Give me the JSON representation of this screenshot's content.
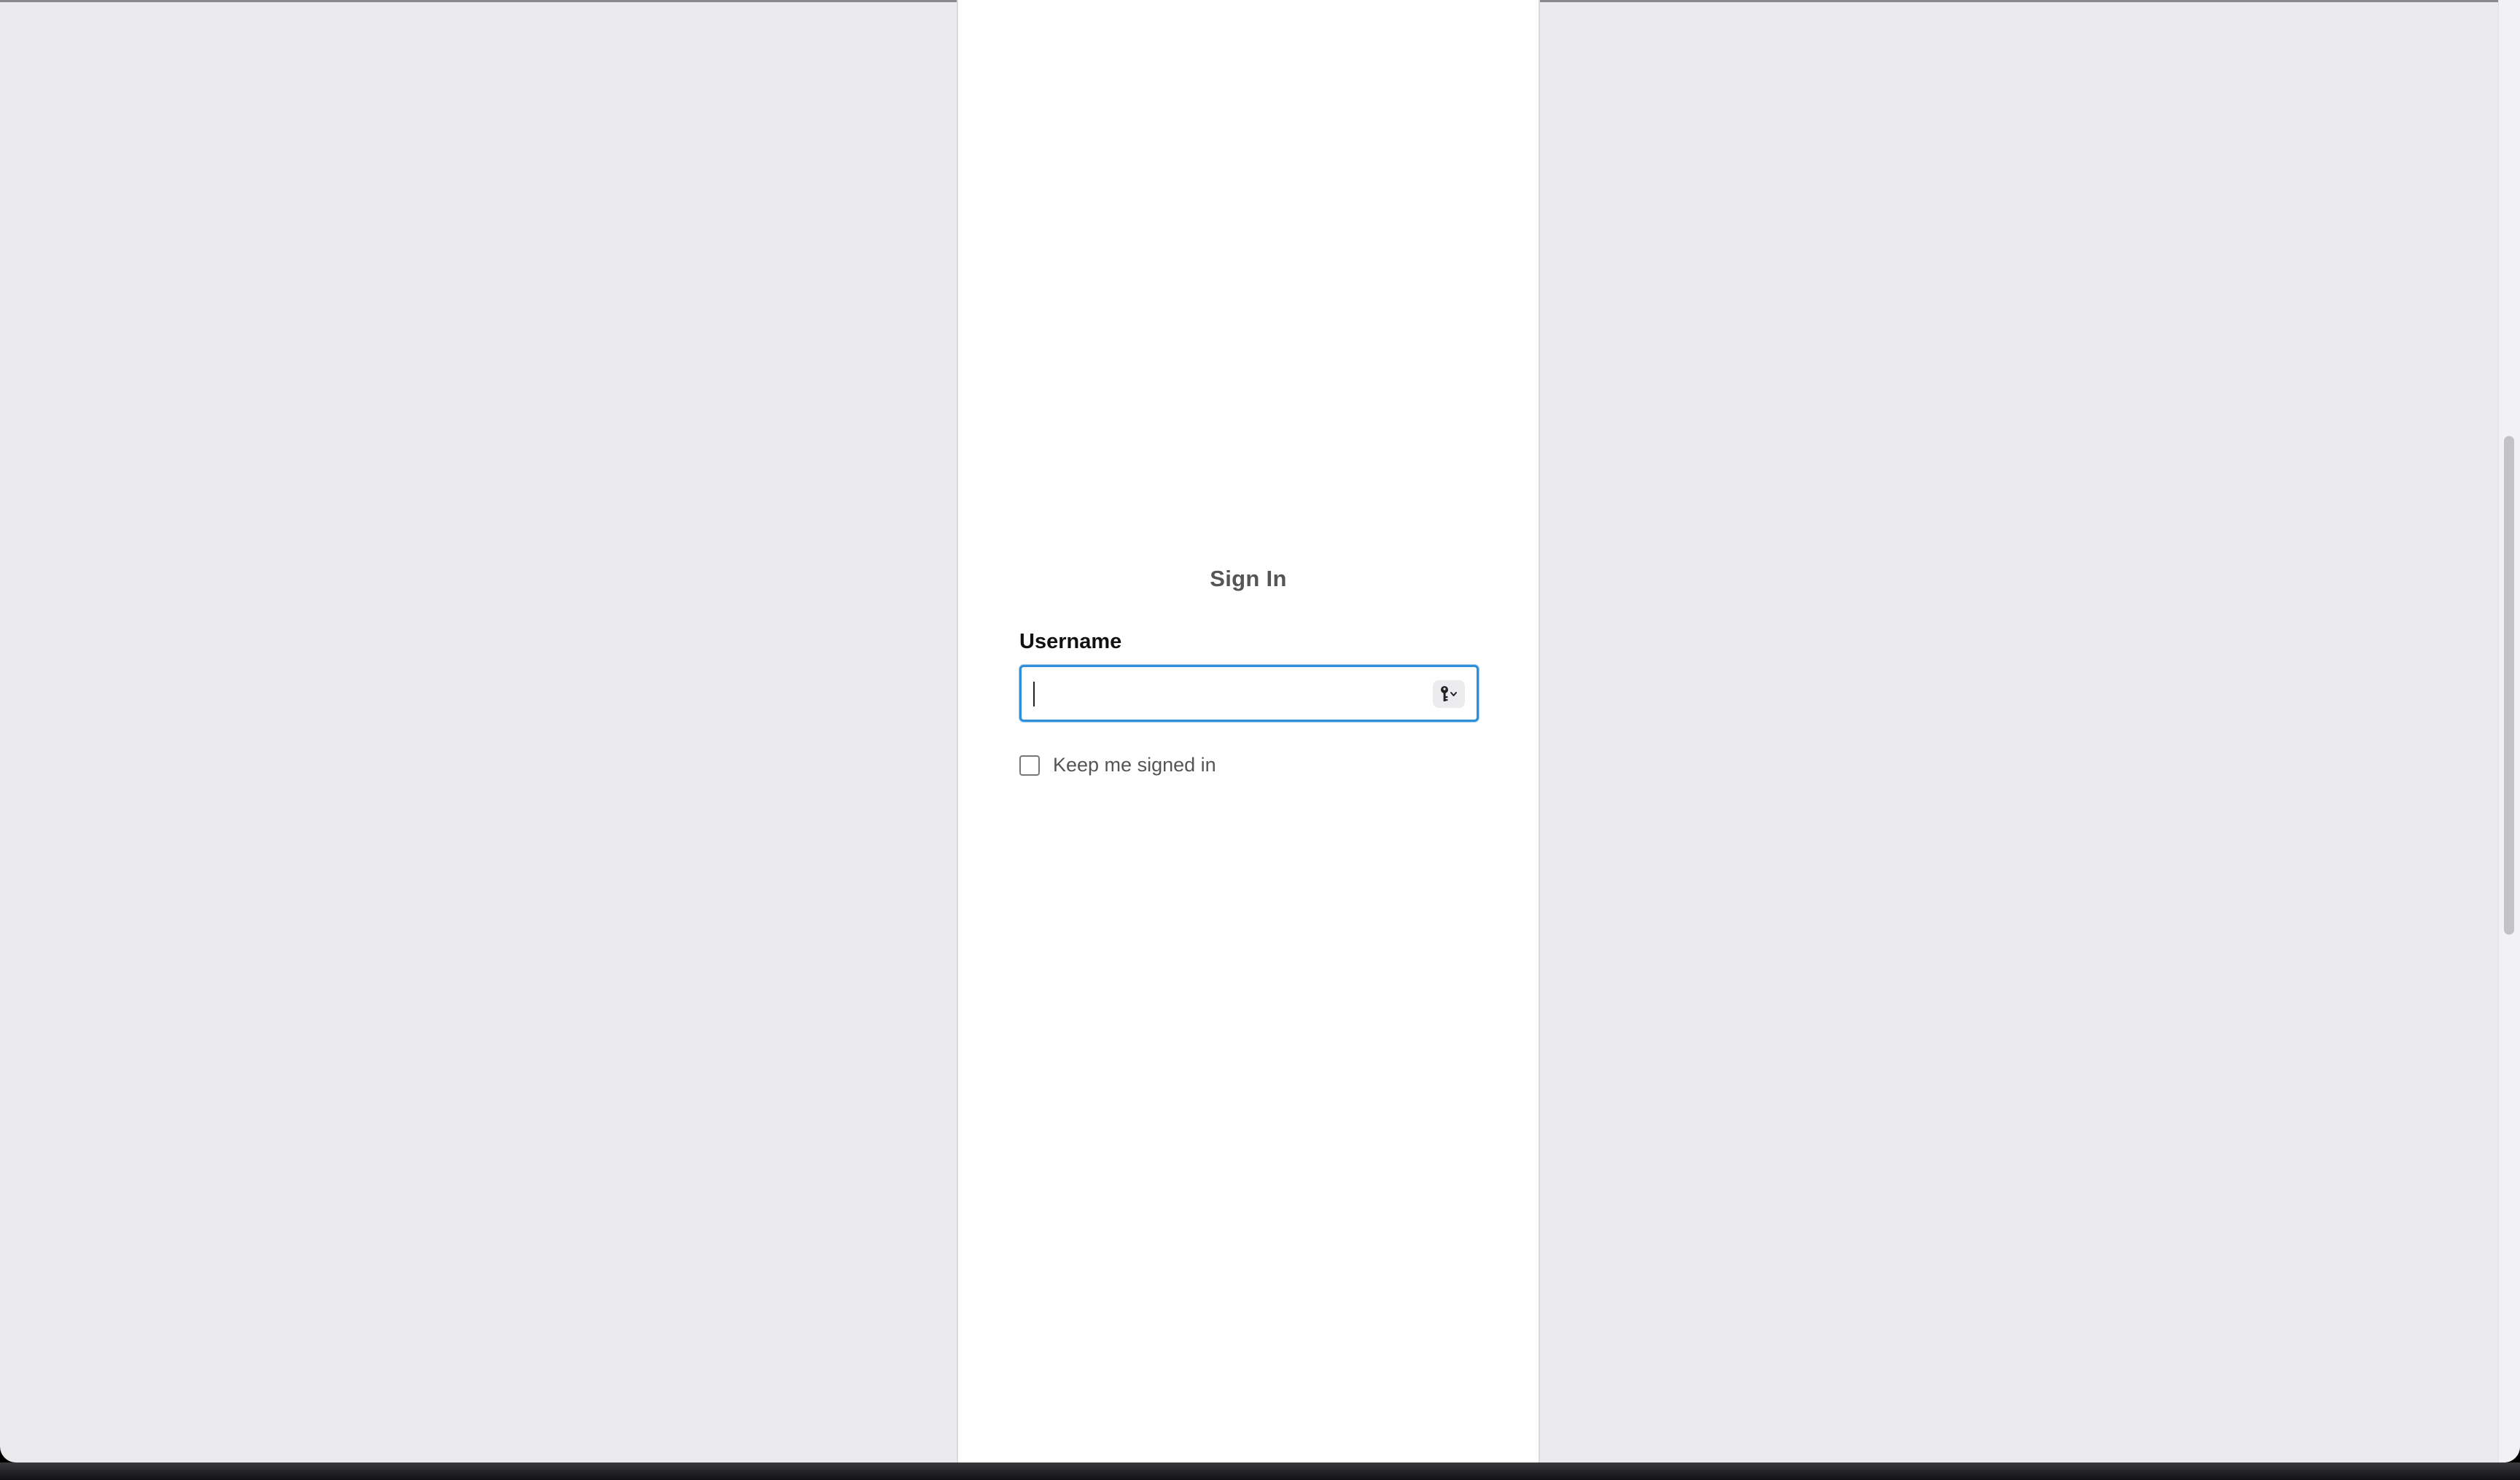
{
  "signin": {
    "title": "Sign In",
    "username_label": "Username",
    "username_value": "",
    "keychain_icon": "key-icon",
    "keep_signed_in_label": "Keep me signed in",
    "keep_signed_in_checked": false
  },
  "colors": {
    "page_background": "#eaeaec",
    "panel_background": "#ffffff",
    "focus_border": "#2f8fd8"
  }
}
